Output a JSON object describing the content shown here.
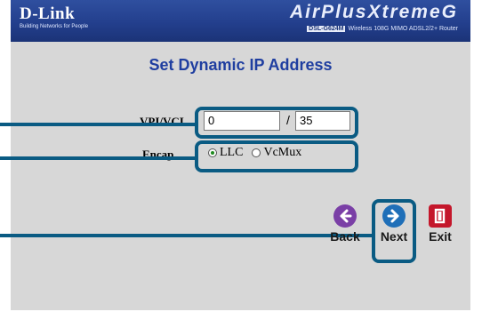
{
  "header": {
    "logo": "D-Link",
    "tagline": "Building Networks for People",
    "product": "AirPlusXtremeG",
    "model_badge": "DSL-G624M",
    "model_desc": "Wireless 108G MIMO ADSL2/2+ Router"
  },
  "page": {
    "title": "Set Dynamic IP Address"
  },
  "form": {
    "vpi_label": "VPI/VCI",
    "vpi_value": "0",
    "separator": "/",
    "vci_value": "35",
    "encap_label": "Encap.",
    "encap_options": [
      {
        "label": "LLC",
        "selected": true
      },
      {
        "label": "VcMux",
        "selected": false
      }
    ]
  },
  "nav": {
    "back_label": "Back",
    "next_label": "Next",
    "exit_label": "Exit"
  },
  "colors": {
    "header_blue": "#233f8d",
    "title_blue": "#1f3ea0",
    "callout_teal": "#0a5b83",
    "back_purple": "#7a3fa6",
    "next_blue": "#1f6fb8",
    "exit_red": "#c4172b"
  }
}
